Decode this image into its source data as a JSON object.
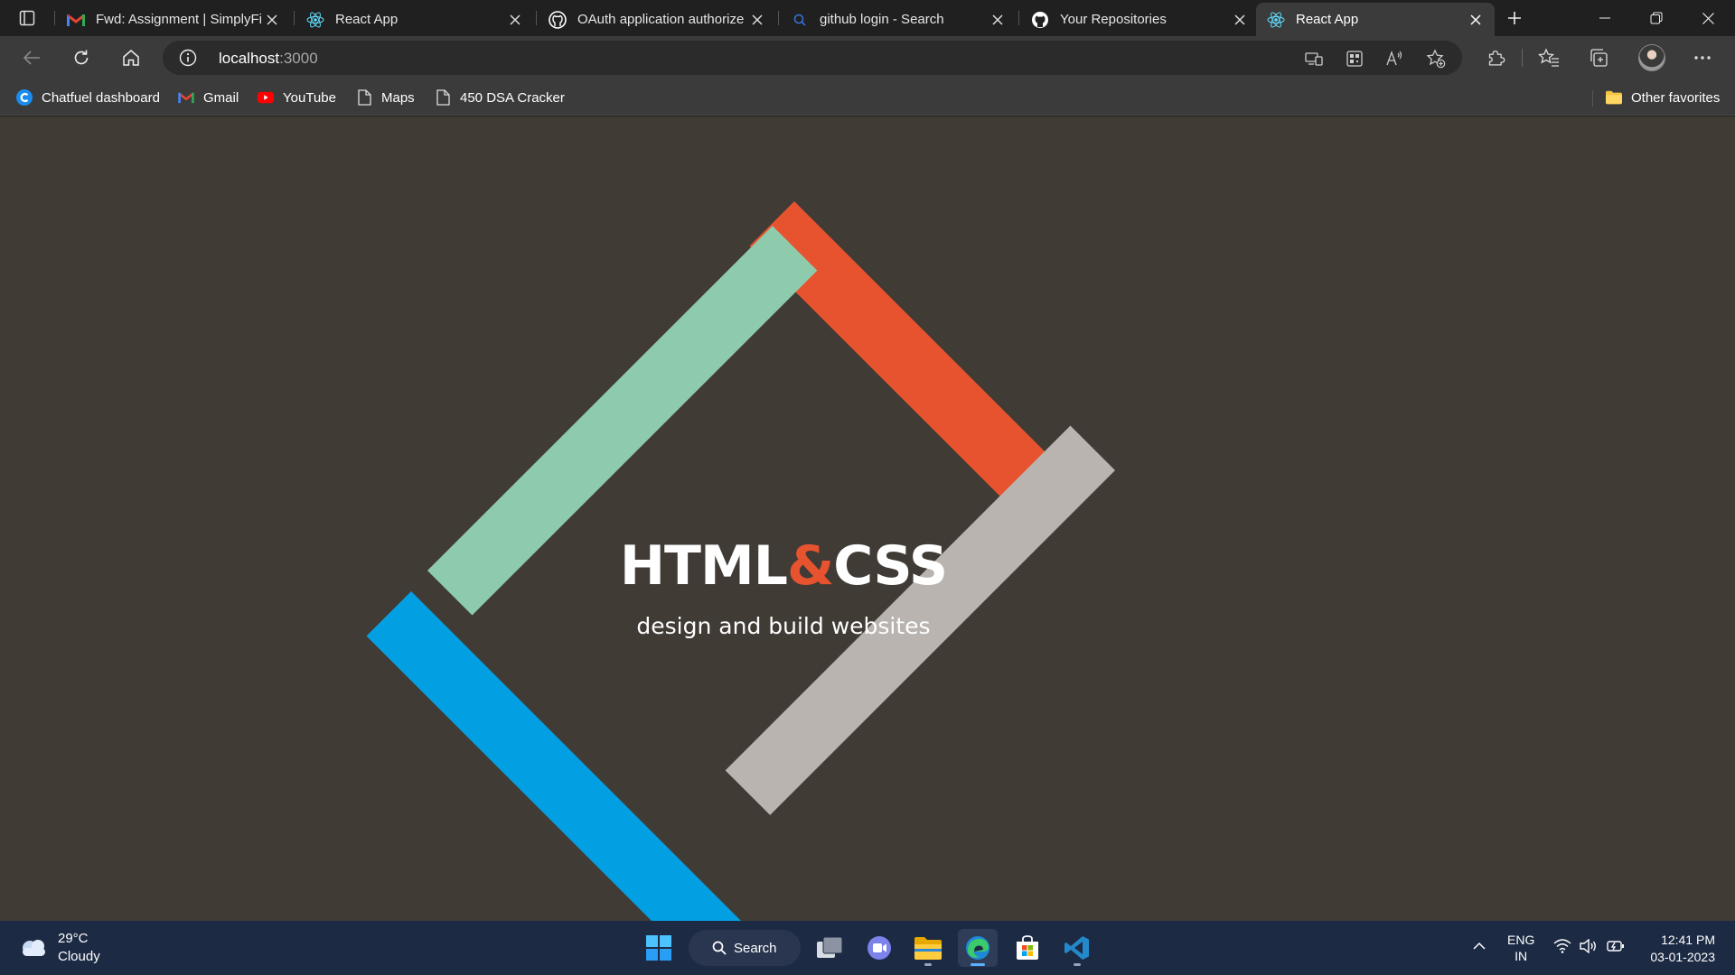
{
  "browser": {
    "tabs": [
      {
        "title": "Fwd: Assignment | SimplyFi",
        "favicon": "gmail-icon",
        "active": false
      },
      {
        "title": "React App",
        "favicon": "react-icon",
        "active": false
      },
      {
        "title": "OAuth application authorize",
        "favicon": "github-icon",
        "active": false
      },
      {
        "title": "github login - Search",
        "favicon": "search-icon",
        "active": false
      },
      {
        "title": "Your Repositories",
        "favicon": "github-icon",
        "active": false
      },
      {
        "title": "React App",
        "favicon": "react-icon",
        "active": true
      }
    ],
    "address": {
      "host": "localhost",
      "port": ":3000"
    },
    "favorites": [
      {
        "label": "Chatfuel dashboard",
        "icon": "chatfuel-icon"
      },
      {
        "label": "Gmail",
        "icon": "gmail-icon"
      },
      {
        "label": "YouTube",
        "icon": "youtube-icon"
      },
      {
        "label": "Maps",
        "icon": "page-icon"
      },
      {
        "label": "450 DSA Cracker",
        "icon": "page-icon"
      }
    ],
    "other_favorites": "Other favorites"
  },
  "page": {
    "title_left": "HTML",
    "title_amp": "&",
    "title_right": "CSS",
    "subtitle": "design and build websites",
    "colors": {
      "background": "#403b35",
      "green": "#8ecbad",
      "red": "#e8532f",
      "gray": "#b9b4b0",
      "blue": "#029fe3"
    }
  },
  "taskbar": {
    "weather": {
      "temp": "29°C",
      "condition": "Cloudy"
    },
    "search_label": "Search",
    "lang": "ENG",
    "region": "IN",
    "time": "12:41 PM",
    "date": "03-01-2023"
  }
}
